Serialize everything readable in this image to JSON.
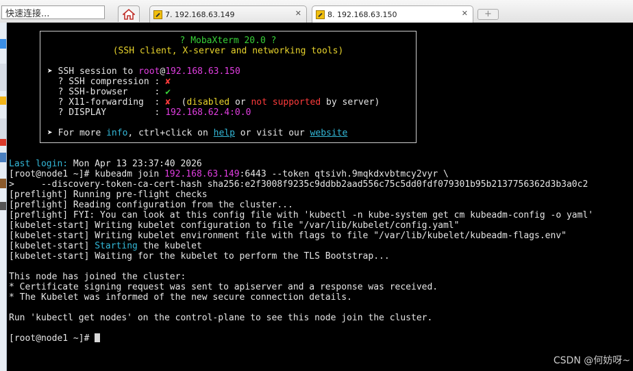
{
  "topbar": {
    "quick_connect_value": "快速连接...",
    "tabs": [
      {
        "label": "7. 192.168.63.149",
        "close": "✕"
      },
      {
        "label": "8. 192.168.63.150",
        "close": "✕"
      }
    ],
    "new_tab_icon": "+"
  },
  "banner": {
    "title": "? MobaXterm 20.0 ?",
    "subtitle": "(SSH client, X-server and networking tools)",
    "arrow": "➤",
    "session_prefix": " SSH session to ",
    "session_user": "root",
    "session_at": "@",
    "session_host": "192.168.63.150",
    "items": [
      {
        "label": "  ? SSH compression : ",
        "value": "✘"
      },
      {
        "label": "  ? SSH-browser     : ",
        "value": "✔"
      },
      {
        "label": "  ? X11-forwarding  : ",
        "value": "✘"
      },
      {
        "label": "  ? DISPLAY         : ",
        "value": "192.168.62.4:0.0"
      }
    ],
    "x11_open": "  (",
    "x11_disabled": "disabled",
    "x11_or": " or ",
    "x11_not_supported": "not supported",
    "x11_tail": " by server)",
    "more_prefix": " For more ",
    "more_info": "info",
    "more_mid": ", ctrl+click on ",
    "more_help": "help",
    "more_visit": " or visit our ",
    "more_website": "website"
  },
  "terminal": {
    "last_login_label": "Last login:",
    "last_login_value": " Mon Apr 13 23:37:40 2026",
    "prompt": "[root@node1 ~]# ",
    "cmd_a": "kubeadm join ",
    "cmd_ip": "192.168.63.149",
    "cmd_b": ":6443 --token qtsivh.9mqkdxvbtmcy2vyr \\",
    "cmd_line2": ">     --discovery-token-ca-cert-hash sha256:e2f3008f9235c9ddbb2aad556c75c5dd0fdf079301b95b2137756362d3b3a0c2",
    "pre1": "[preflight] Running pre-flight checks",
    "pre2": "[preflight] Reading configuration from the cluster...",
    "pre3": "[preflight] FYI: You can look at this config file with 'kubectl -n kube-system get cm kubeadm-config -o yaml'",
    "kub1": "[kubelet-start] Writing kubelet configuration to file \"/var/lib/kubelet/config.yaml\"",
    "kub2": "[kubelet-start] Writing kubelet environment file with flags to file \"/var/lib/kubelet/kubeadm-flags.env\"",
    "kub3_prefix": "[kubelet-start] ",
    "kub3_starting": "Starting",
    "kub3_suffix": " the kubelet",
    "kub4": "[kubelet-start] Waiting for the kubelet to perform the TLS Bootstrap...",
    "joined": "This node has joined the cluster:",
    "star1": "* Certificate signing request was sent to apiserver and a response was received.",
    "star2": "* The Kubelet was informed of the new secure connection details.",
    "run": "Run 'kubectl get nodes' on the control-plane to see this node join the cluster.",
    "final_prompt": "[root@node1 ~]# "
  },
  "watermark": "CSDN @何妨呀~",
  "colors": {
    "terminal_bg": "#000000",
    "green": "#38d238",
    "yellow": "#e8d42c",
    "magenta": "#e13ee1",
    "red": "#ff3b3b",
    "cyan": "#33b8d8"
  },
  "icons": {
    "home": "home-icon",
    "tab": "wrench-icon",
    "close": "close-icon",
    "new_tab": "plus-icon"
  }
}
